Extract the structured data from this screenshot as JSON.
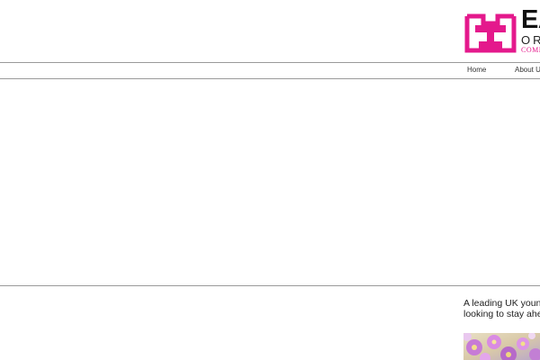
{
  "brand": {
    "wordmark": "EA",
    "subline": "ORN",
    "tagline": "COMM",
    "accent_color": "#e4198c",
    "logo_icon": "book-rail-icon"
  },
  "nav": {
    "items": [
      {
        "label": "Home"
      },
      {
        "label": "About Us"
      }
    ]
  },
  "intro": {
    "line1": "A leading UK young",
    "line2": "looking to stay ahea"
  },
  "photo": {
    "subject": "pink-flowers-image"
  }
}
